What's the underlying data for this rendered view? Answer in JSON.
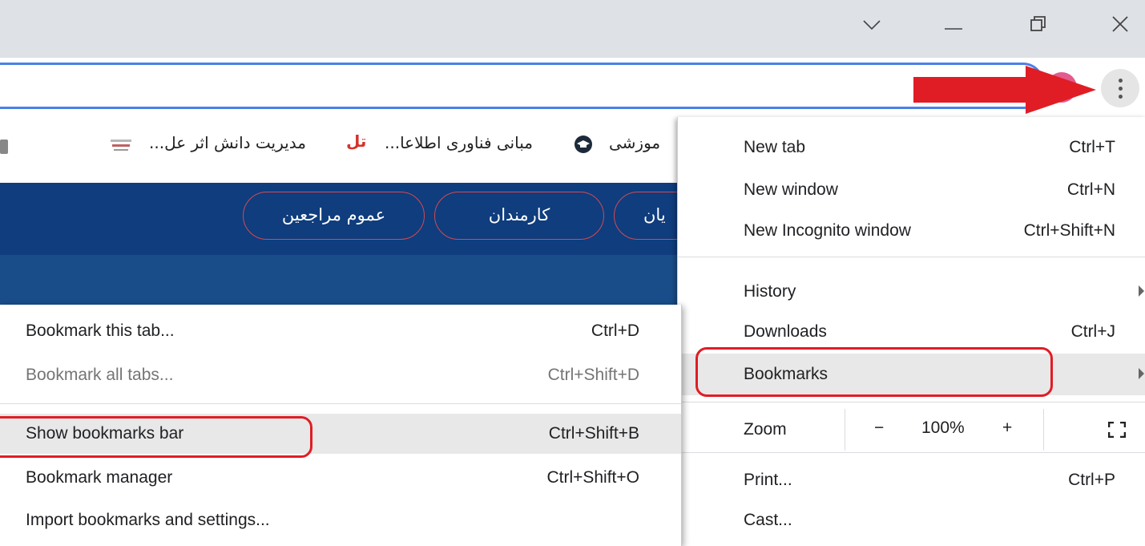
{
  "window_controls": {
    "dropdown_glyph": "∨",
    "minimize_glyph": "—",
    "close_glyph": "✕"
  },
  "bookmarks_bar": {
    "items": [
      {
        "label": "موزشی"
      },
      {
        "label": "مبانی فناوری اطلاعا..."
      },
      {
        "label": "مدیریت دانش اثر عل..."
      }
    ],
    "tl_logo_text": "تل"
  },
  "page_nav": {
    "pills": [
      {
        "label": "عموم مراجعین"
      },
      {
        "label": "کارمندان"
      },
      {
        "label": "یان"
      }
    ]
  },
  "menu": {
    "new_tab": {
      "label": "New tab",
      "shortcut": "Ctrl+T"
    },
    "new_window": {
      "label": "New window",
      "shortcut": "Ctrl+N"
    },
    "new_incognito": {
      "label": "New Incognito window",
      "shortcut": "Ctrl+Shift+N"
    },
    "history": {
      "label": "History"
    },
    "downloads": {
      "label": "Downloads",
      "shortcut": "Ctrl+J"
    },
    "bookmarks": {
      "label": "Bookmarks"
    },
    "zoom": {
      "label": "Zoom",
      "minus": "−",
      "value": "100%",
      "plus": "+"
    },
    "print": {
      "label": "Print...",
      "shortcut": "Ctrl+P"
    },
    "cast": {
      "label": "Cast..."
    }
  },
  "submenu": {
    "bookmark_tab": {
      "label": "Bookmark this tab...",
      "shortcut": "Ctrl+D"
    },
    "bookmark_all": {
      "label": "Bookmark all tabs...",
      "shortcut": "Ctrl+Shift+D"
    },
    "show_bar": {
      "label": "Show bookmarks bar",
      "shortcut": "Ctrl+Shift+B"
    },
    "manager": {
      "label": "Bookmark manager",
      "shortcut": "Ctrl+Shift+O"
    },
    "import": {
      "label": "Import bookmarks and settings..."
    }
  },
  "colors": {
    "annotation_red": "#e01d25",
    "omnibox_focus": "#4a80e8",
    "page_blue": "#0f3d7d"
  }
}
